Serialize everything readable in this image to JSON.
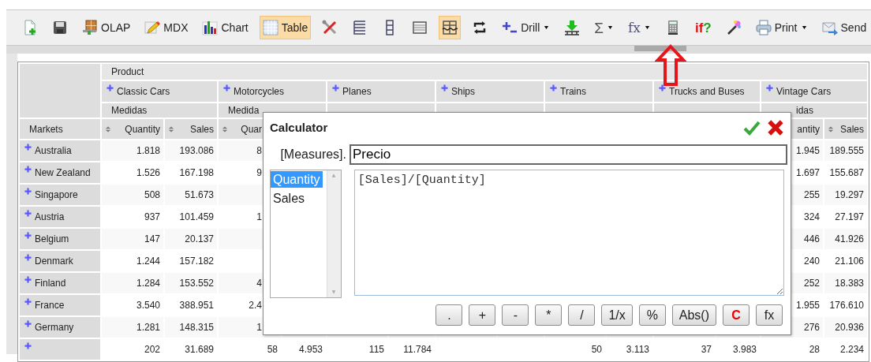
{
  "toolbar": [
    {
      "kind": "new",
      "selected": false,
      "dropdown": false
    },
    {
      "kind": "save",
      "selected": false,
      "dropdown": false
    },
    {
      "kind": "olap",
      "label": "OLAP",
      "selected": false,
      "dropdown": false
    },
    {
      "kind": "mdx",
      "label": "MDX",
      "selected": false,
      "dropdown": false
    },
    {
      "kind": "chart",
      "label": "Chart",
      "selected": false,
      "dropdown": false
    },
    {
      "kind": "table",
      "label": "Table",
      "selected": true,
      "dropdown": false
    },
    {
      "kind": "tools",
      "selected": false,
      "dropdown": false
    },
    {
      "kind": "tree",
      "selected": false,
      "dropdown": false
    },
    {
      "kind": "columns",
      "selected": false,
      "dropdown": false
    },
    {
      "kind": "grid",
      "selected": false,
      "dropdown": false
    },
    {
      "kind": "layout",
      "selected": true,
      "dropdown": false
    },
    {
      "kind": "swap",
      "selected": false,
      "dropdown": false
    },
    {
      "kind": "drill",
      "label": "Drill",
      "selected": false,
      "dropdown": true
    },
    {
      "kind": "export",
      "selected": false,
      "dropdown": false
    },
    {
      "kind": "glyph",
      "glyph": "Σ",
      "selected": false,
      "dropdown": true
    },
    {
      "kind": "glyph",
      "glyph": "fx",
      "selected": false,
      "dropdown": true
    },
    {
      "kind": "calculator",
      "selected": false,
      "dropdown": false
    },
    {
      "kind": "condition",
      "glyph_parts": [
        "if",
        "?"
      ],
      "selected": false,
      "dropdown": false
    },
    {
      "kind": "wand",
      "selected": false,
      "dropdown": false
    },
    {
      "kind": "print",
      "label": "Print",
      "selected": false,
      "dropdown": true
    },
    {
      "kind": "send",
      "label": "Send",
      "selected": false,
      "dropdown": false
    }
  ],
  "pivot": {
    "dimension": "Product",
    "row_header": "Markets",
    "groups": [
      {
        "label": "Classic Cars",
        "measure_label": "Medidas",
        "quantity_header": {
          "label": "Quantity",
          "sort_icon": true
        },
        "sales_header": {
          "label": "Sales",
          "sort_icon": true
        }
      },
      {
        "label": "Motorcycles",
        "measure_label": "Medida",
        "quantity_header": {
          "label": "Quar",
          "sort_icon": true
        }
      },
      {
        "label": "Planes"
      },
      {
        "label": "Ships"
      },
      {
        "label": "Trains"
      },
      {
        "label": "Trucks and Buses"
      },
      {
        "label": "Vintage Cars",
        "measure_label": "idas",
        "quantity_header": {
          "label": "antity"
        },
        "sales_header": {
          "label": "Sales",
          "sort_icon": true
        }
      }
    ],
    "rows": [
      {
        "market": "Australia",
        "classic_cars": {
          "quantity": "1.818",
          "sales": "193.086"
        },
        "motorcycles": {
          "quantity": "8"
        },
        "vintage_cars": {
          "quantity": "1.945",
          "sales": "189.555"
        }
      },
      {
        "market": "New Zealand",
        "classic_cars": {
          "quantity": "1.526",
          "sales": "167.198"
        },
        "motorcycles": {
          "quantity": "9"
        },
        "vintage_cars": {
          "quantity": "1.697",
          "sales": "155.687"
        }
      },
      {
        "market": "Singapore",
        "classic_cars": {
          "quantity": "508",
          "sales": "51.673"
        },
        "vintage_cars": {
          "quantity": "255",
          "sales": "19.297"
        }
      },
      {
        "market": "Austria",
        "classic_cars": {
          "quantity": "937",
          "sales": "101.459"
        },
        "motorcycles": {
          "quantity": "1"
        },
        "vintage_cars": {
          "quantity": "324",
          "sales": "27.197"
        }
      },
      {
        "market": "Belgium",
        "classic_cars": {
          "quantity": "147",
          "sales": "20.137"
        },
        "vintage_cars": {
          "quantity": "446",
          "sales": "41.926"
        }
      },
      {
        "market": "Denmark",
        "classic_cars": {
          "quantity": "1.244",
          "sales": "157.182"
        },
        "vintage_cars": {
          "quantity": "240",
          "sales": "21.106"
        }
      },
      {
        "market": "Finland",
        "classic_cars": {
          "quantity": "1.284",
          "sales": "153.552"
        },
        "motorcycles": {
          "quantity": "4"
        },
        "vintage_cars": {
          "quantity": "252",
          "sales": "18.383"
        }
      },
      {
        "market": "France",
        "classic_cars": {
          "quantity": "3.540",
          "sales": "388.951"
        },
        "motorcycles": {
          "quantity": "2.4"
        },
        "vintage_cars": {
          "quantity": "1.955",
          "sales": "176.610"
        }
      },
      {
        "market": "Germany",
        "classic_cars": {
          "quantity": "1.281",
          "sales": "148.315"
        },
        "motorcycles": {
          "quantity": "1"
        },
        "vintage_cars": {
          "quantity": "276",
          "sales": "20.936"
        }
      },
      {
        "classic_cars": {
          "quantity": "202",
          "sales": "31.689"
        },
        "motorcycles": {
          "quantity": "58",
          "sales": "4.953"
        },
        "planes": {
          "quantity": "115",
          "sales": "11.784"
        },
        "trains": {
          "quantity": "50",
          "sales": "3.113"
        },
        "trucks_and_buses": {
          "quantity": "37",
          "sales": "3.983"
        },
        "vintage_cars": {
          "quantity": "28",
          "sales": "2.234"
        }
      }
    ]
  },
  "calculator": {
    "title": "Calculator",
    "prefix": "[Measures].",
    "name_value": "Precio",
    "measures": [
      {
        "label": "Quantity",
        "selected": true
      },
      {
        "label": "Sales",
        "selected": false
      }
    ],
    "expression": "[Sales]/[Quantity]",
    "keys": [
      {
        "label": ".",
        "kind": "plain"
      },
      {
        "label": "+",
        "kind": "plain"
      },
      {
        "label": "-",
        "kind": "plain"
      },
      {
        "label": "*",
        "kind": "plain"
      },
      {
        "label": "/",
        "kind": "plain"
      },
      {
        "label": "1/x",
        "kind": "plain"
      },
      {
        "label": "%",
        "kind": "plain"
      },
      {
        "label": "Abs()",
        "kind": "plain"
      },
      {
        "label": "C",
        "kind": "clear"
      },
      {
        "label": "fx",
        "kind": "plain"
      }
    ]
  }
}
